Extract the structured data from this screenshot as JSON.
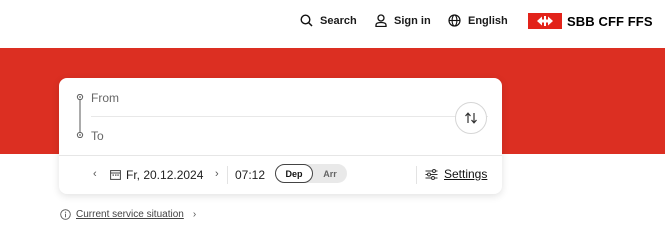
{
  "header": {
    "search_label": "Search",
    "signin_label": "Sign in",
    "language_label": "English",
    "brand_text": "SBB CFF FFS"
  },
  "colors": {
    "brand_red": "#dc2f22",
    "logo_red": "#e2231a"
  },
  "form": {
    "from_placeholder": "From",
    "to_placeholder": "To",
    "date": "Fr, 20.12.2024",
    "time": "07:12",
    "dep_label": "Dep",
    "arr_label": "Arr",
    "selected_mode": "Dep",
    "settings_label": "Settings"
  },
  "footer": {
    "service_link": "Current service situation"
  }
}
